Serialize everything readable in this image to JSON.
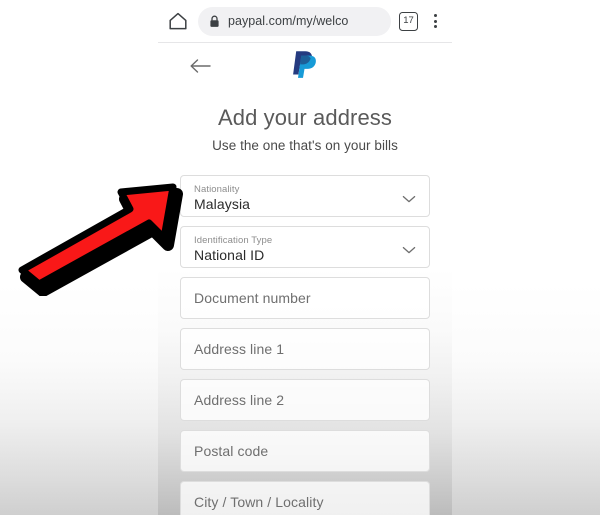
{
  "browser": {
    "home_icon": "home-icon",
    "lock_icon": "lock-icon",
    "url": "paypal.com/my/welco",
    "tab_count": "17",
    "menu_icon": "overflow-menu-icon"
  },
  "page": {
    "back_icon": "back-arrow-icon",
    "logo": "paypal-logo",
    "title": "Add your address",
    "subtitle": "Use the one that's on your bills"
  },
  "form": {
    "fields": [
      {
        "name": "nationality",
        "type": "select",
        "label": "Nationality",
        "value": "Malaysia",
        "chevron": "chevron-down-icon"
      },
      {
        "name": "identification-type",
        "type": "select",
        "label": "Identification Type",
        "value": "National ID",
        "chevron": "chevron-down-icon"
      },
      {
        "name": "document-number",
        "type": "text",
        "placeholder": "Document number"
      },
      {
        "name": "address-line-1",
        "type": "text",
        "placeholder": "Address line 1"
      },
      {
        "name": "address-line-2",
        "type": "text",
        "placeholder": "Address line 2"
      },
      {
        "name": "postal-code",
        "type": "text",
        "placeholder": "Postal code"
      },
      {
        "name": "city-town-locality",
        "type": "text",
        "placeholder": "City / Town / Locality"
      }
    ]
  },
  "annotation": {
    "arrow_icon": "red-arrow-annotation",
    "fill_color": "#f91818",
    "outline_color": "#000000",
    "points_at": "nationality"
  },
  "colors": {
    "paypal_dark_blue": "#253b80",
    "paypal_light_blue": "#179bd7",
    "toolbar_background": "#ffffff",
    "url_pill_background": "#f1f1f3"
  }
}
